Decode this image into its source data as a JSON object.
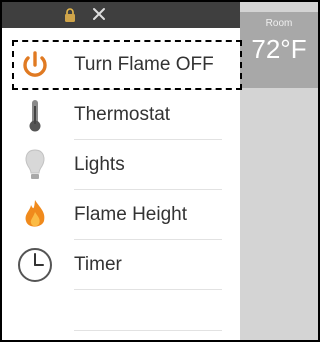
{
  "menu": {
    "items": [
      {
        "label": "Turn Flame OFF"
      },
      {
        "label": "Thermostat"
      },
      {
        "label": "Lights"
      },
      {
        "label": "Flame Height"
      },
      {
        "label": "Timer"
      }
    ]
  },
  "room": {
    "label": "Room",
    "temperature": "72°F"
  },
  "colors": {
    "power_icon": "#e07a22",
    "flame_icon": "#f08a1c",
    "topbar": "#3f3f3f",
    "room_panel": "#a8a8a8"
  },
  "icons": {
    "topbar": [
      "lock-icon",
      "wrench-icon"
    ],
    "items": [
      "power-icon",
      "thermometer-icon",
      "lightbulb-icon",
      "flame-icon",
      "clock-icon"
    ]
  }
}
